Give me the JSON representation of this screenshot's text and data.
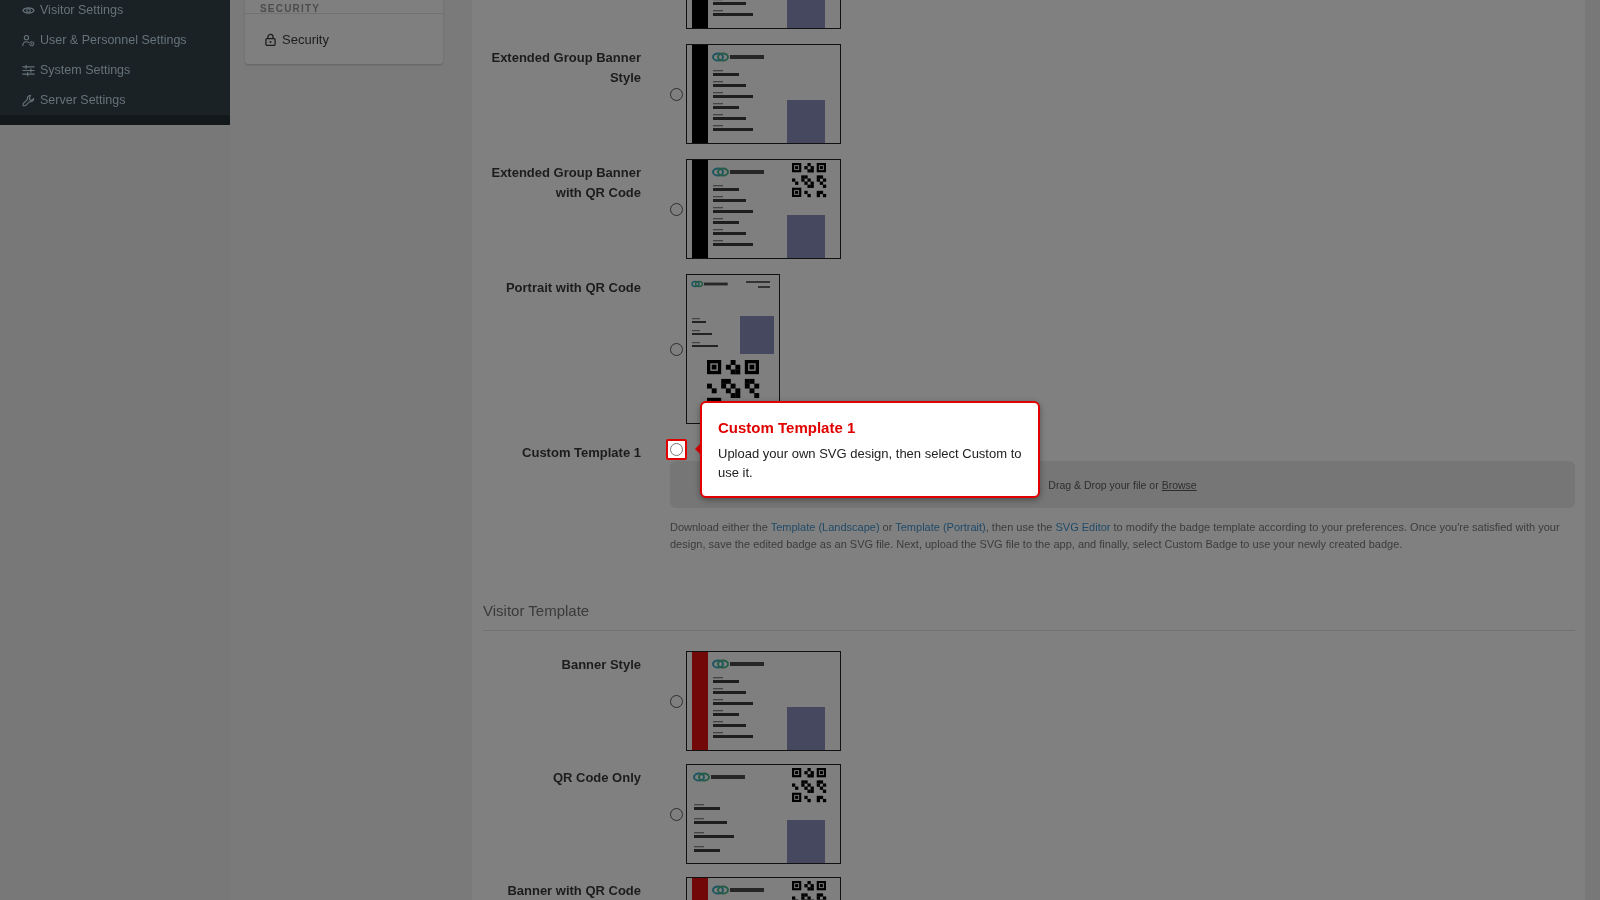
{
  "sidebar": {
    "items": [
      {
        "label": "Visitor Settings"
      },
      {
        "label": "User & Personnel Settings"
      },
      {
        "label": "System Settings"
      },
      {
        "label": "Server Settings"
      }
    ]
  },
  "settings_nav": {
    "header": "SECURITY",
    "items": [
      {
        "label": "Security"
      }
    ]
  },
  "sections": [
    {
      "items": [
        {
          "kind": "preview",
          "preview": {
            "kind": "landscape",
            "banner": {
              "color": "#000000"
            },
            "qr": false
          }
        },
        {
          "kind": "preview",
          "label": "Extended Group Banner Style",
          "selected": false,
          "highlighted": false,
          "preview": {
            "kind": "landscape",
            "banner": {
              "color": "#000000"
            },
            "qr": false
          }
        },
        {
          "kind": "preview",
          "label": "Extended Group Banner with QR Code",
          "selected": false,
          "highlighted": false,
          "preview": {
            "kind": "landscape",
            "banner": {
              "color": "#000000"
            },
            "qr": true
          }
        },
        {
          "kind": "preview",
          "label": "Portrait with QR Code",
          "selected": false,
          "highlighted": false,
          "preview": {
            "kind": "portrait",
            "qr": true
          }
        },
        {
          "kind": "upload",
          "label": "Custom Template 1",
          "selected": false,
          "highlighted": true,
          "dropzone": {
            "prompt": "Drag & Drop your file or",
            "link": "Browse"
          },
          "help": [
            {
              "kind": "text",
              "text": "Download either the "
            },
            {
              "kind": "link",
              "text": "Template (Landscape)"
            },
            {
              "kind": "text",
              "text": " or "
            },
            {
              "kind": "link",
              "text": "Template (Portrait)"
            },
            {
              "kind": "text",
              "text": ", then use the "
            },
            {
              "kind": "link",
              "text": "SVG Editor"
            },
            {
              "kind": "text",
              "text": " to modify the badge template according to your preferences. Once you're satisfied with your design, save the edited badge as an SVG file. Next, upload the SVG file to the app, and finally, select Custom Badge to use your newly created badge."
            }
          ]
        }
      ]
    },
    {
      "heading": "Visitor Template",
      "items": [
        {
          "kind": "preview",
          "label": "Banner Style",
          "selected": false,
          "highlighted": false,
          "preview": {
            "kind": "landscape",
            "banner": {
              "color": "#720808"
            },
            "qr": false
          }
        },
        {
          "kind": "preview",
          "label": "QR Code Only",
          "selected": false,
          "highlighted": false,
          "preview": {
            "kind": "landscape",
            "qr": true
          }
        },
        {
          "kind": "preview",
          "label": "Banner with QR Code",
          "preview": {
            "kind": "landscape",
            "banner": {
              "color": "#720808"
            },
            "qr": true
          }
        }
      ]
    }
  ],
  "tour_tip": {
    "title": "Custom Template 1",
    "text": "Upload your own SVG design, then select Custom to use it."
  }
}
